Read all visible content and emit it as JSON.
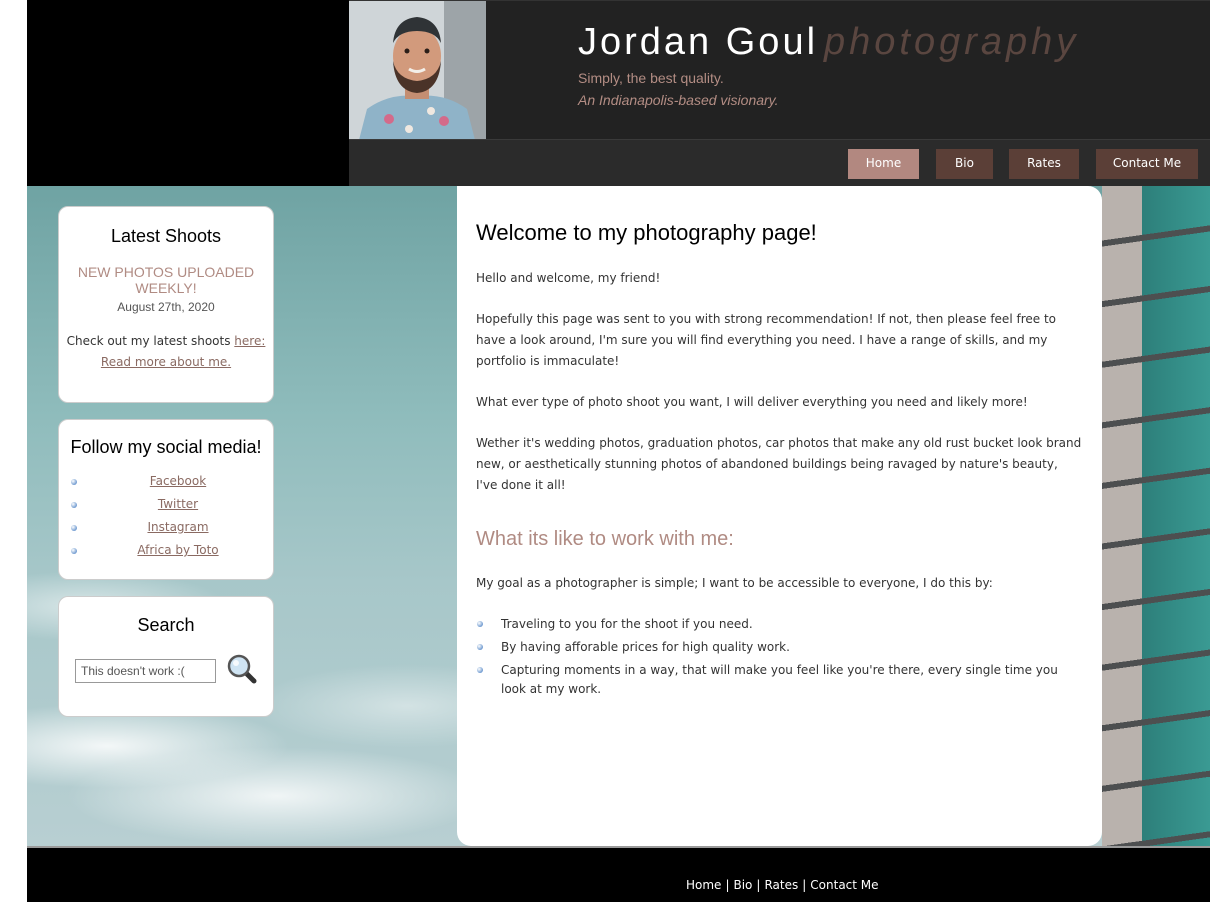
{
  "header": {
    "title": "Jordan Goul",
    "title_sub": "photography",
    "tagline_1": "Simply, the best quality.",
    "tagline_2": "An Indianapolis-based visionary."
  },
  "nav": {
    "items": [
      {
        "label": "Home",
        "active": true
      },
      {
        "label": "Bio",
        "active": false
      },
      {
        "label": "Rates",
        "active": false
      },
      {
        "label": "Contact Me",
        "active": false
      }
    ]
  },
  "sidebar": {
    "latest": {
      "title": "Latest Shoots",
      "headline": "NEW PHOTOS UPLOADED WEEKLY!",
      "date": "August 27th, 2020",
      "text": "Check out my latest shoots",
      "here_link": "here:",
      "read_more": "Read more about me."
    },
    "social": {
      "title": "Follow my social media!",
      "links": [
        "Facebook",
        "Twitter",
        "Instagram",
        "Africa by Toto"
      ]
    },
    "search": {
      "title": "Search",
      "value": "This doesn't work :("
    }
  },
  "content": {
    "heading": "Welcome to my photography page!",
    "p1": "Hello and welcome, my friend!",
    "p2": "Hopefully this page was sent to you with strong recommendation! If not, then please feel free to have a look around, I'm sure you will find everything you need. I have a range of skills, and my portfolio is immaculate!",
    "p3": "What ever type of photo shoot you want, I will deliver everything you need and likely more!",
    "p4": "Wether it's wedding photos, graduation photos, car photos that make any old rust bucket look brand new, or aesthetically stunning photos of abandoned buildings being ravaged by nature's beauty, I've done it all!",
    "subheading": "What its like to work with me:",
    "goal": "My goal as a photographer is simple; I want to be accessible to everyone, I do this by:",
    "list": [
      "Traveling to you for the shoot if you need.",
      "By having afforable prices for high quality work.",
      "Capturing moments in a way, that will make you feel like you're there, every single time you look at my work."
    ]
  },
  "footer": {
    "links": [
      "Home",
      "Bio",
      "Rates",
      "Contact Me"
    ],
    "separator": "|"
  },
  "colors": {
    "accent": "#b08b83",
    "nav_button": "#5b3f37",
    "nav_active": "#b28880",
    "header_bg": "#222222"
  }
}
